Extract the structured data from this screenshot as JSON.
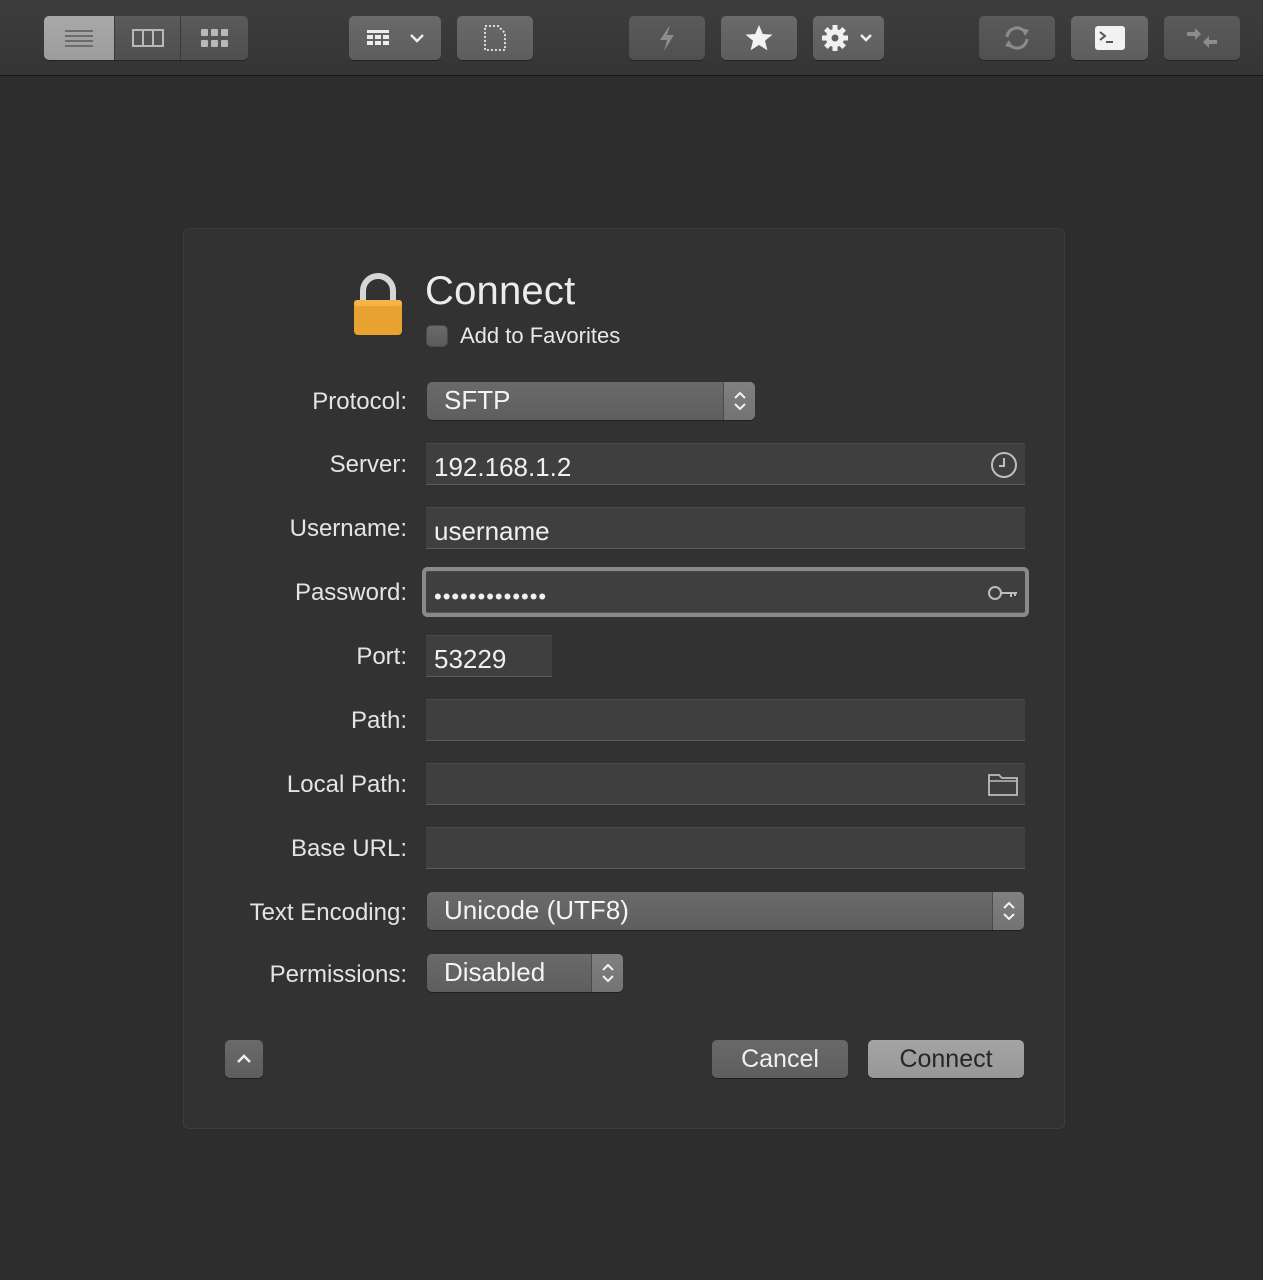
{
  "toolbar": {
    "view_modes": [
      {
        "icon": "list-view-icon",
        "active": true
      },
      {
        "icon": "column-view-icon",
        "active": false
      },
      {
        "icon": "icon-view-icon",
        "active": false
      }
    ],
    "buttons": [
      {
        "icon": "action-menu-icon"
      },
      {
        "icon": "new-file-icon"
      },
      {
        "icon": "quick-connect-icon"
      },
      {
        "icon": "favorites-star-icon"
      },
      {
        "icon": "settings-gear-icon"
      },
      {
        "icon": "refresh-icon"
      },
      {
        "icon": "terminal-icon"
      },
      {
        "icon": "disconnect-icon"
      }
    ]
  },
  "dialog": {
    "title": "Connect",
    "add_to_favorites_label": "Add to Favorites",
    "add_to_favorites_checked": false,
    "lock_color": "#e8a22f",
    "fields": {
      "protocol": {
        "label": "Protocol:",
        "value": "SFTP"
      },
      "server": {
        "label": "Server:",
        "value": "192.168.1.2"
      },
      "username": {
        "label": "Username:",
        "value": "username"
      },
      "password": {
        "label": "Password:",
        "value": "•••••••••••••"
      },
      "port": {
        "label": "Port:",
        "value": "53229"
      },
      "path": {
        "label": "Path:",
        "value": ""
      },
      "local_path": {
        "label": "Local Path:",
        "value": ""
      },
      "base_url": {
        "label": "Base URL:",
        "value": ""
      },
      "text_encoding": {
        "label": "Text Encoding:",
        "value": "Unicode (UTF8)"
      },
      "permissions": {
        "label": "Permissions:",
        "value": "Disabled"
      }
    },
    "cancel_label": "Cancel",
    "connect_label": "Connect"
  }
}
